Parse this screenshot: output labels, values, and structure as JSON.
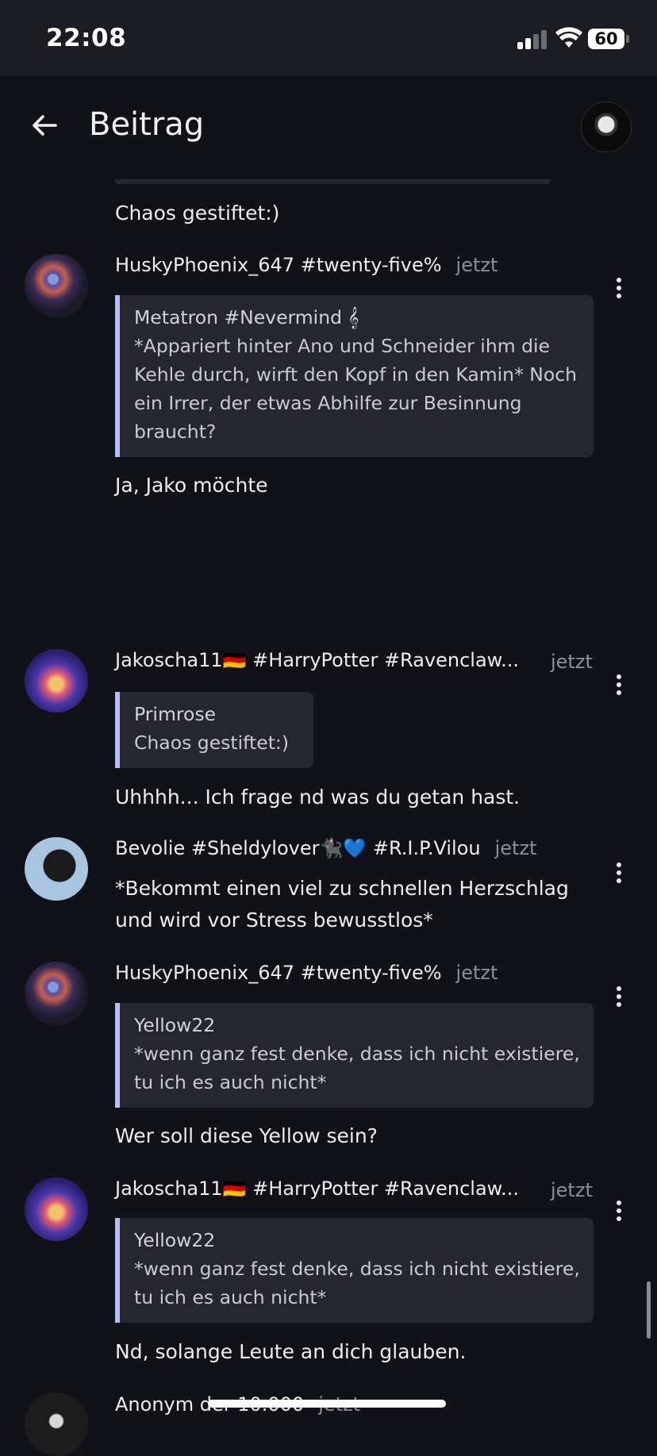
{
  "status_bar": {
    "time": "22:08",
    "battery": "60"
  },
  "header": {
    "title": "Beitrag"
  },
  "top_fragment_text": "Chaos gestiftet:)",
  "posts": [
    {
      "author": "HuskyPhoenix_647 #twenty-five%",
      "time": "jetzt",
      "quote_author": "Metatron #Nevermind 𝄞",
      "quote_text": "*Appariert hinter Ano und Schneider ihm die Kehle durch, wirft den Kopf in den Kamin* Noch ein Irrer, der etwas Abhilfe zur Besinnung braucht?",
      "text": "Ja, Jako möchte"
    },
    {
      "author": "Jakoscha11🇩🇪 #HarryPotter #Ravenclaw...",
      "time": "jetzt",
      "quote_author": "Primrose",
      "quote_text": "Chaos gestiftet:)",
      "text": "Uhhhh... Ich frage nd was du getan hast."
    },
    {
      "author": "Bevolie #Sheldylover🐈‍⬛💙 #R.I.P.Vilou",
      "time": "jetzt",
      "text": "*Bekommt einen viel zu schnellen Herzschlag und wird vor Stress bewusstlos*"
    },
    {
      "author": "HuskyPhoenix_647 #twenty-five%",
      "time": "jetzt",
      "quote_author": "Yellow22",
      "quote_text": "*wenn ganz fest denke, dass ich nicht existiere, tu ich es auch nicht*",
      "text": "Wer soll diese Yellow sein?"
    },
    {
      "author": "Jakoscha11🇩🇪 #HarryPotter #Ravenclaw...",
      "time": "jetzt",
      "quote_author": "Yellow22",
      "quote_text": "*wenn ganz fest denke, dass ich nicht existiere, tu ich es auch nicht*",
      "text": "Nd, solange Leute an dich glauben."
    },
    {
      "author": "Anonym der 10.000",
      "time": "jetzt"
    }
  ]
}
